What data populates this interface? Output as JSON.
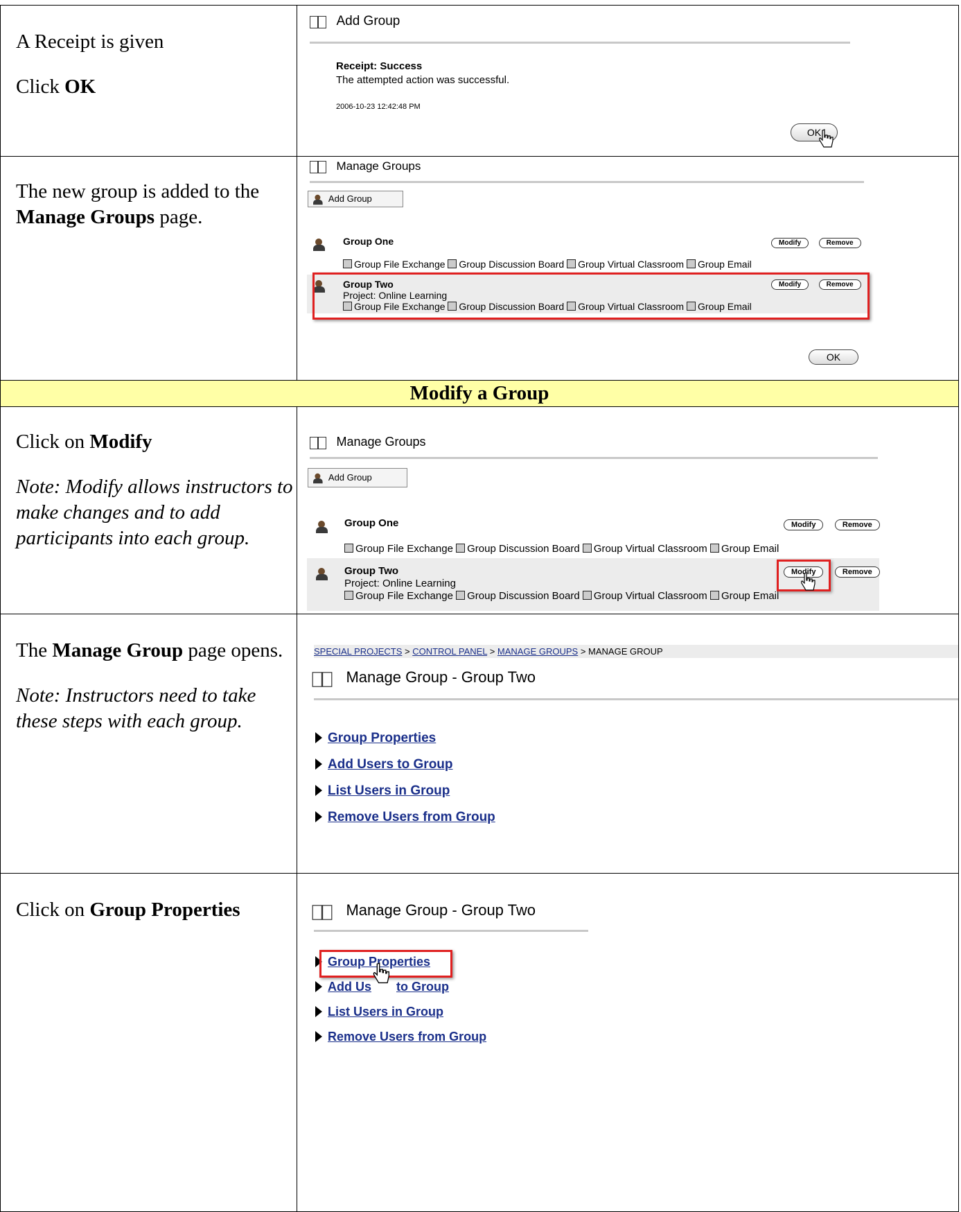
{
  "rows": [
    {
      "text1": "A Receipt is given",
      "text2_prefix": "Click ",
      "text2_bold": "OK"
    },
    {
      "text_prefix": "The new group is added to the ",
      "text_bold": "Manage Groups",
      "text_suffix": " page."
    },
    {
      "section": "Modify a Group"
    },
    {
      "prefix": "Click on ",
      "bold": "Modify",
      "note": "Note: Modify allows instructors to make changes and to add participants into each group."
    },
    {
      "prefix": "The ",
      "bold": "Manage Group",
      "suffix": " page opens.",
      "note": "Note: Instructors need to take these steps with each group."
    },
    {
      "prefix": "Click on ",
      "bold": "Group Properties"
    }
  ],
  "screens": {
    "receipt": {
      "title": "Add Group",
      "receipt_title": "Receipt: Success",
      "receipt_msg": "The attempted action was successful.",
      "timestamp": "2006-10-23 12:42:48 PM",
      "ok": "OK"
    },
    "manage_groups": {
      "title": "Manage Groups",
      "add_group": "Add Group",
      "modify": "Modify",
      "remove": "Remove",
      "ok": "OK",
      "groups": [
        {
          "name": "Group One",
          "project": ""
        },
        {
          "name": "Group Two",
          "project": "Project: Online Learning"
        }
      ],
      "tools": [
        "Group File Exchange",
        "Group Discussion Board",
        "Group Virtual Classroom",
        "Group Email"
      ]
    },
    "manage_group": {
      "breadcrumb": [
        "SPECIAL PROJECTS",
        "CONTROL PANEL",
        "MANAGE GROUPS",
        "MANAGE GROUP"
      ],
      "title": "Manage Group - Group Two",
      "links": [
        "Group Properties",
        "Add Users to Group",
        "List Users in Group",
        "Remove Users from Group"
      ]
    },
    "group_props": {
      "title": "Manage Group - Group Two",
      "links": [
        "Group Properties",
        "Add Us",
        "to Group",
        "List Users in Group",
        "Remove Users from Group"
      ]
    }
  }
}
